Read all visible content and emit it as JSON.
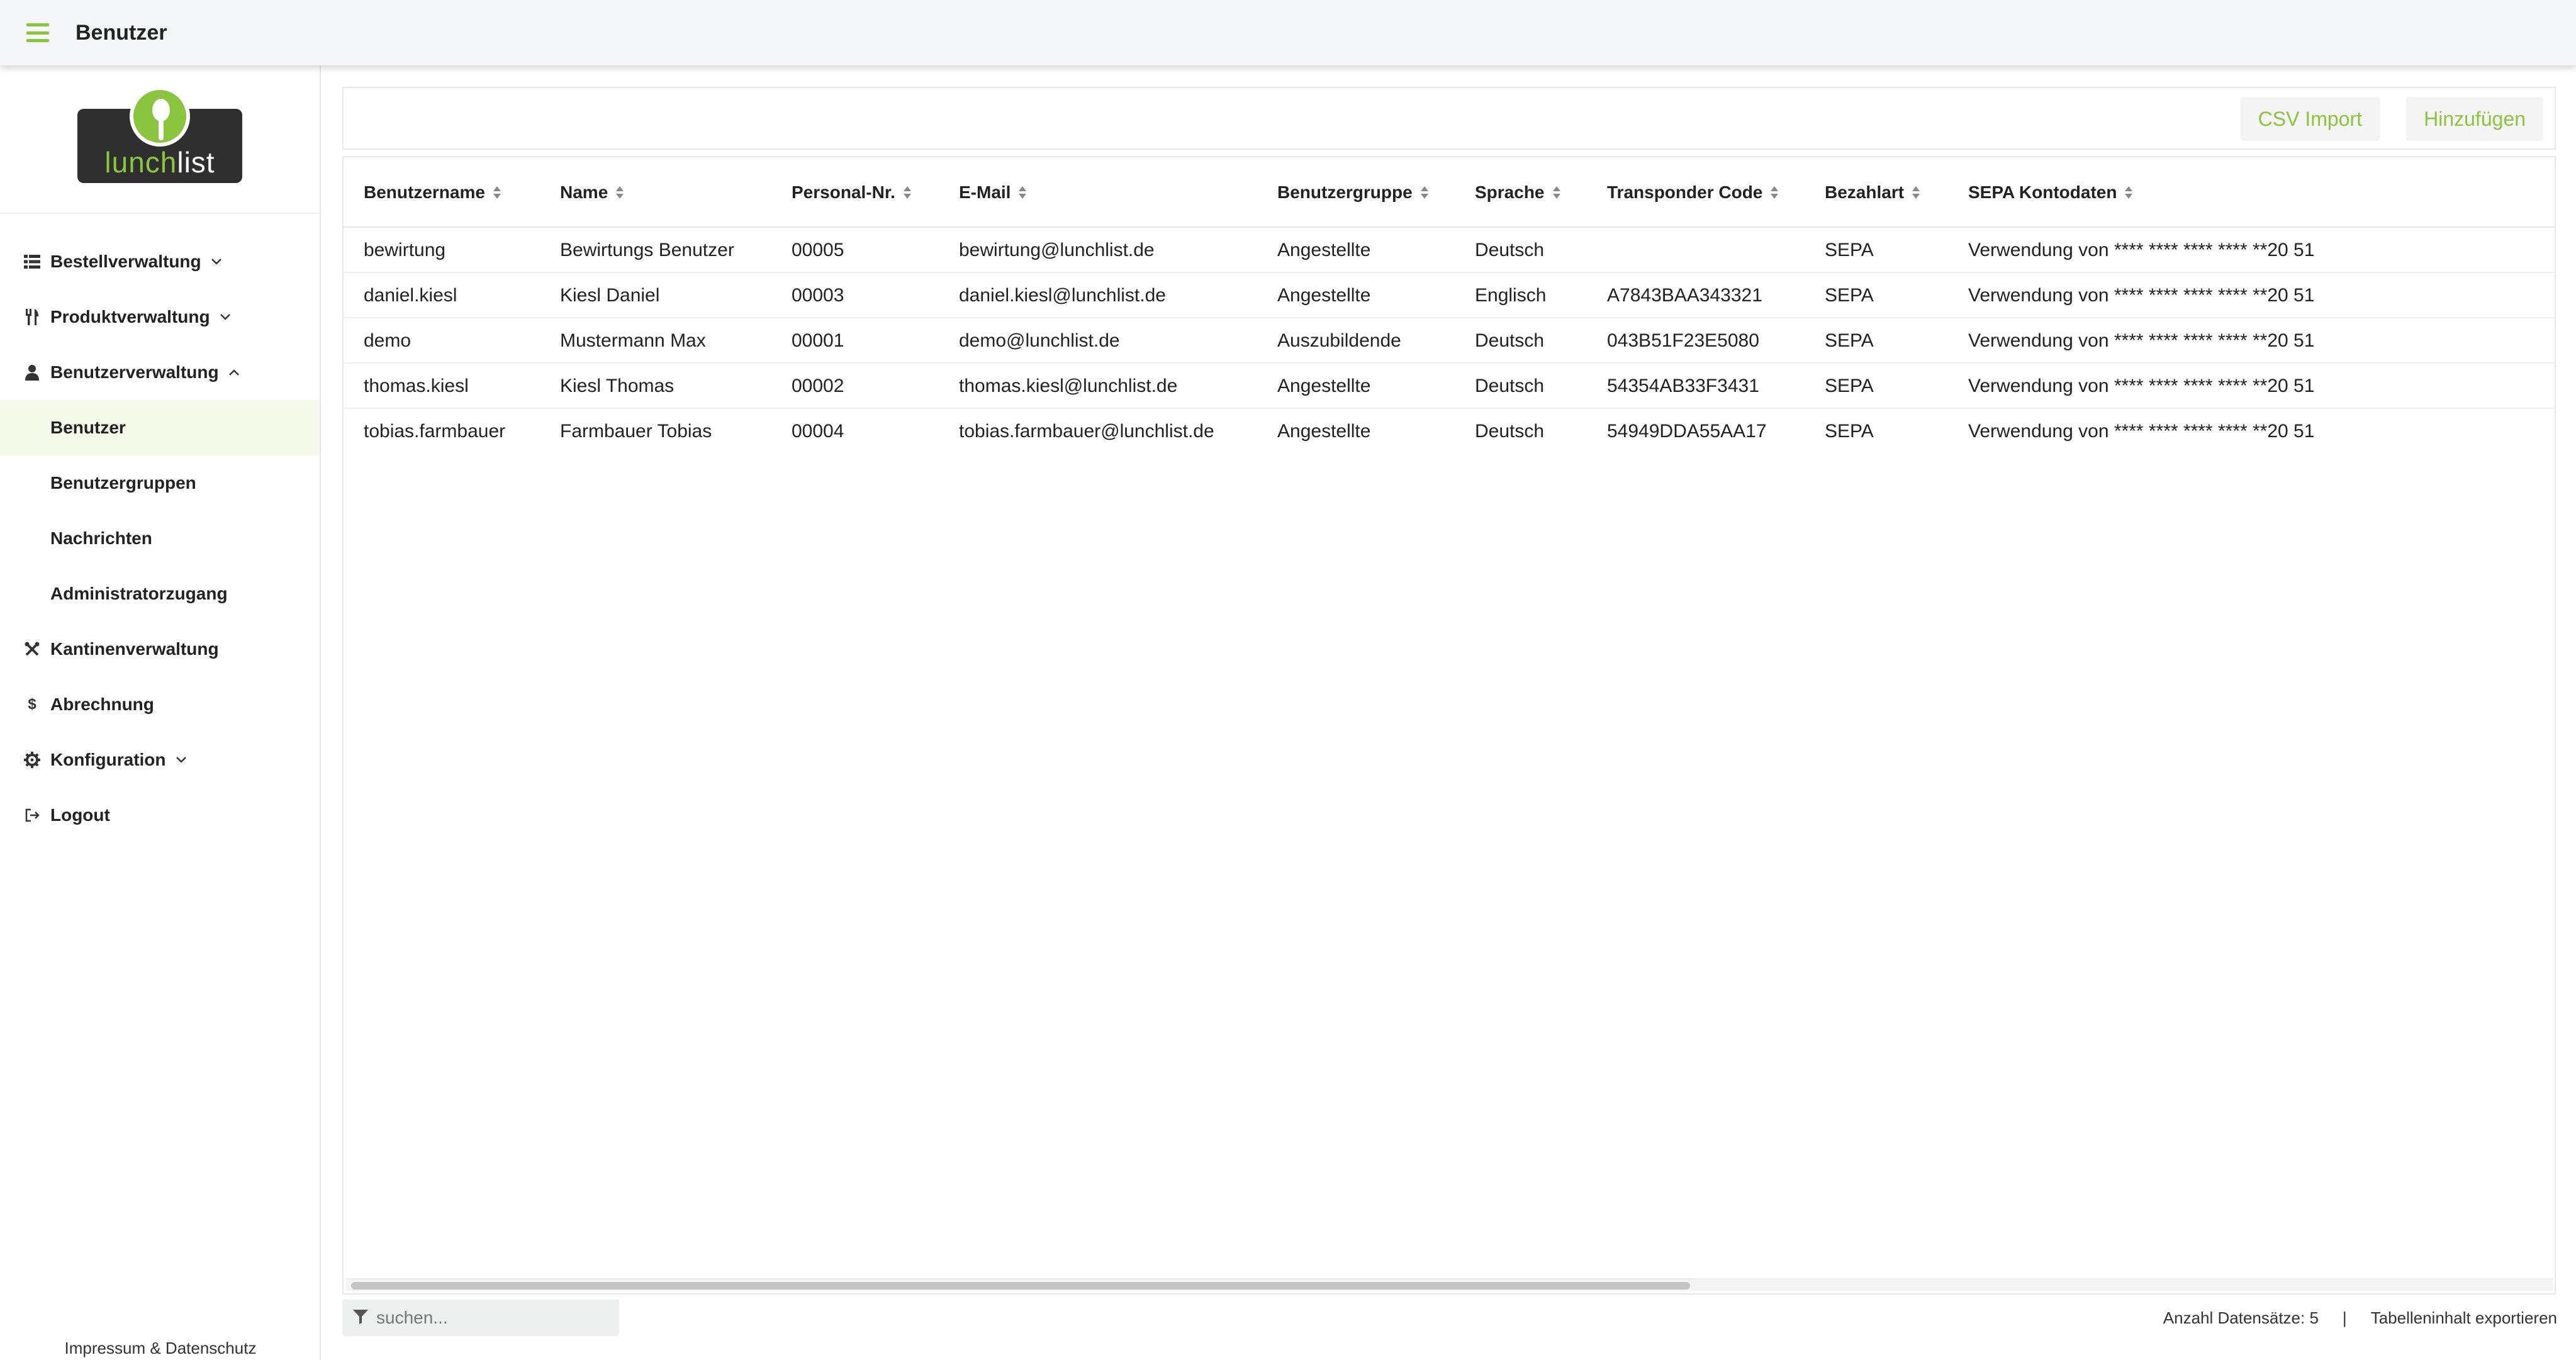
{
  "header": {
    "title": "Benutzer"
  },
  "logo": {
    "text_part1": "lunch",
    "text_part2": "list"
  },
  "sidebar": {
    "items": [
      {
        "label": "Bestellverwaltung",
        "icon": "list-icon",
        "chevron": "down"
      },
      {
        "label": "Produktverwaltung",
        "icon": "utensils-icon",
        "chevron": "down"
      },
      {
        "label": "Benutzerverwaltung",
        "icon": "user-icon",
        "chevron": "up"
      },
      {
        "label": "Kantinenverwaltung",
        "icon": "tools-icon"
      },
      {
        "label": "Abrechnung",
        "icon": "dollar-icon"
      },
      {
        "label": "Konfiguration",
        "icon": "gear-icon",
        "chevron": "down"
      },
      {
        "label": "Logout",
        "icon": "logout-icon"
      }
    ],
    "subitems": [
      {
        "label": "Benutzer",
        "active": true
      },
      {
        "label": "Benutzergruppen"
      },
      {
        "label": "Nachrichten"
      },
      {
        "label": "Administratorzugang"
      }
    ],
    "footer": "Impressum & Datenschutz"
  },
  "toolbar": {
    "csv_import_label": "CSV Import",
    "add_label": "Hinzufügen"
  },
  "table": {
    "columns": [
      "Benutzername",
      "Name",
      "Personal-Nr.",
      "E-Mail",
      "Benutzergruppe",
      "Sprache",
      "Transponder Code",
      "Bezahlart",
      "SEPA Kontodaten"
    ],
    "rows": [
      [
        "bewirtung",
        "Bewirtungs Benutzer",
        "00005",
        "bewirtung@lunchlist.de",
        "Angestellte",
        "Deutsch",
        "",
        "SEPA",
        "Verwendung von **** **** **** **** **20 51"
      ],
      [
        "daniel.kiesl",
        "Kiesl Daniel",
        "00003",
        "daniel.kiesl@lunchlist.de",
        "Angestellte",
        "Englisch",
        "A7843BAA343321",
        "SEPA",
        "Verwendung von **** **** **** **** **20 51"
      ],
      [
        "demo",
        "Mustermann Max",
        "00001",
        "demo@lunchlist.de",
        "Auszubildende",
        "Deutsch",
        "043B51F23E5080",
        "SEPA",
        "Verwendung von **** **** **** **** **20 51"
      ],
      [
        "thomas.kiesl",
        "Kiesl Thomas",
        "00002",
        "thomas.kiesl@lunchlist.de",
        "Angestellte",
        "Deutsch",
        "54354AB33F3431",
        "SEPA",
        "Verwendung von **** **** **** **** **20 51"
      ],
      [
        "tobias.farmbauer",
        "Farmbauer Tobias",
        "00004",
        "tobias.farmbauer@lunchlist.de",
        "Angestellte",
        "Deutsch",
        "54949DDA55AA17",
        "SEPA",
        "Verwendung von **** **** **** **** **20 51"
      ]
    ]
  },
  "search": {
    "placeholder": "suchen..."
  },
  "status": {
    "record_count": "Anzahl Datensätze: 5",
    "separator": "|",
    "export_label": "Tabelleninhalt exportieren"
  },
  "colors": {
    "accent": "#8bc53f",
    "active_bg": "#f4f9ea"
  }
}
